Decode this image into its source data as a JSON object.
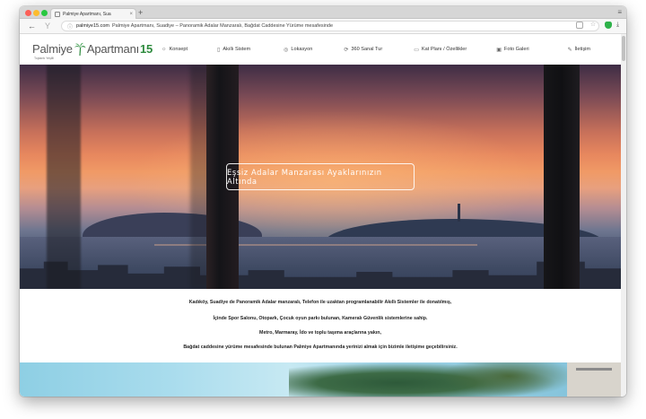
{
  "browser": {
    "tab_title": "Palmiye Apartmanı, Sua",
    "tab_close": "×",
    "new_tab": "+",
    "url": "palmiye15.com",
    "page_title": "Palmiye Apartmanı, Suadiye – Panoramik Adalar Manzaralı, Bağdat Caddesine Yürüme mesafesinde"
  },
  "site": {
    "logo_word1": "Palmiye",
    "logo_word2": "Apartmanı",
    "logo_num": "15",
    "logo_sub": "Toplantı Yeşilli",
    "nav": [
      {
        "icon": "☼",
        "label": "Konsept"
      },
      {
        "icon": "▯",
        "label": "Akıllı Sistem"
      },
      {
        "icon": "◎",
        "label": "Lokasyon"
      },
      {
        "icon": "⟳",
        "label": "360 Sanal Tur"
      },
      {
        "icon": "▭",
        "label": "Kat Planı / Özellikler"
      },
      {
        "icon": "▣",
        "label": "Foto Galeri"
      },
      {
        "icon": "✎",
        "label": "İletişim"
      }
    ],
    "hero_title": "Eşsiz Adalar Manzarası Ayaklarınızın Altında",
    "intro": [
      "Kadıköy, Suadiye de Panoramik Adalar manzaralı, Telefon ile uzaktan programlanabilir Akıllı Sistemler ile donatılmış,",
      "İçinde Spor Salonu, Otopark, Çocuk oyun parkı bulunan, Kameralı Güvenlik sistemlerine sahip.",
      "Metro, Marmaray, İdo ve toplu taşıma araçlarına yakın,",
      "Bağdat caddesine yürüme mesafesinde bulunan Palmiye Apartmanında yerinizi almak için bizimle iletişime geçebilirsiniz."
    ]
  },
  "colors": {
    "logo_green": "#2e8b3e",
    "tl_red": "#fc5f57",
    "tl_yellow": "#fdbc2e",
    "tl_green": "#28c840"
  }
}
